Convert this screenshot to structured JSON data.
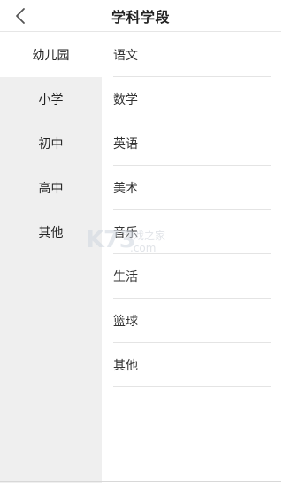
{
  "header": {
    "title": "学科学段",
    "back_icon": "chevron-left-icon"
  },
  "sidebar": {
    "items": [
      {
        "label": "幼儿园",
        "active": true
      },
      {
        "label": "小学",
        "active": false
      },
      {
        "label": "初中",
        "active": false
      },
      {
        "label": "高中",
        "active": false
      },
      {
        "label": "其他",
        "active": false
      }
    ]
  },
  "subjects": {
    "items": [
      {
        "label": "语文"
      },
      {
        "label": "数学"
      },
      {
        "label": "英语"
      },
      {
        "label": "美术"
      },
      {
        "label": "音乐"
      },
      {
        "label": "生活"
      },
      {
        "label": "篮球"
      },
      {
        "label": "其他"
      }
    ]
  },
  "watermark": {
    "logo": "K73",
    "text": "游戏之家",
    "sub": ".com"
  },
  "colors": {
    "sidebar_bg": "#efefef",
    "active_bg": "#ffffff",
    "divider": "#e4e4e4"
  }
}
